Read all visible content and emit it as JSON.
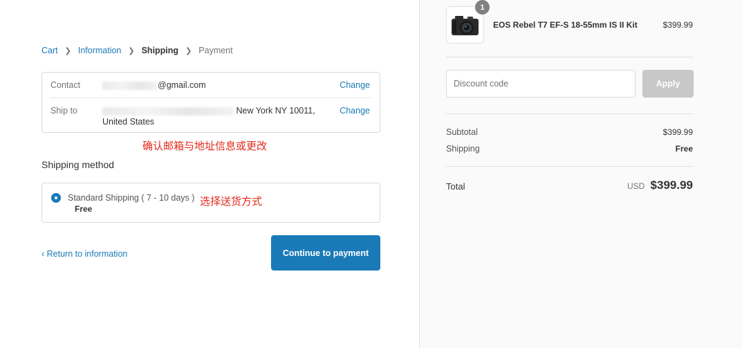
{
  "breadcrumb": {
    "cart": "Cart",
    "information": "Information",
    "shipping": "Shipping",
    "payment": "Payment"
  },
  "review": {
    "contact_label": "Contact",
    "contact_value": "@gmail.com",
    "ship_to_label": "Ship to",
    "ship_to_value_line1": "New York NY 10011,",
    "ship_to_value_line2": "United States",
    "change_label": "Change"
  },
  "annotations": {
    "confirm_note": "确认邮箱与地址信息或更改",
    "choose_note": "选择送货方式"
  },
  "shipping_method": {
    "title": "Shipping method",
    "option_name": "Standard Shipping ( 7 - 10 days )",
    "option_price": "Free",
    "selected": true
  },
  "nav": {
    "return_label": "‹ Return to information",
    "continue_label": "Continue to payment"
  },
  "order": {
    "quantity": "1",
    "product_name": "EOS Rebel T7 EF-S 18-55mm IS II Kit",
    "product_price": "$399.99",
    "discount_placeholder": "Discount code",
    "apply_label": "Apply",
    "subtotal_label": "Subtotal",
    "subtotal_value": "$399.99",
    "shipping_label": "Shipping",
    "shipping_value": "Free",
    "total_label": "Total",
    "currency": "USD",
    "total_value": "$399.99"
  },
  "colors": {
    "accent": "#1a7ab8",
    "annotation": "#e4291c",
    "sidebar_bg": "#fafafa",
    "apply_disabled": "#c8c8c8"
  }
}
